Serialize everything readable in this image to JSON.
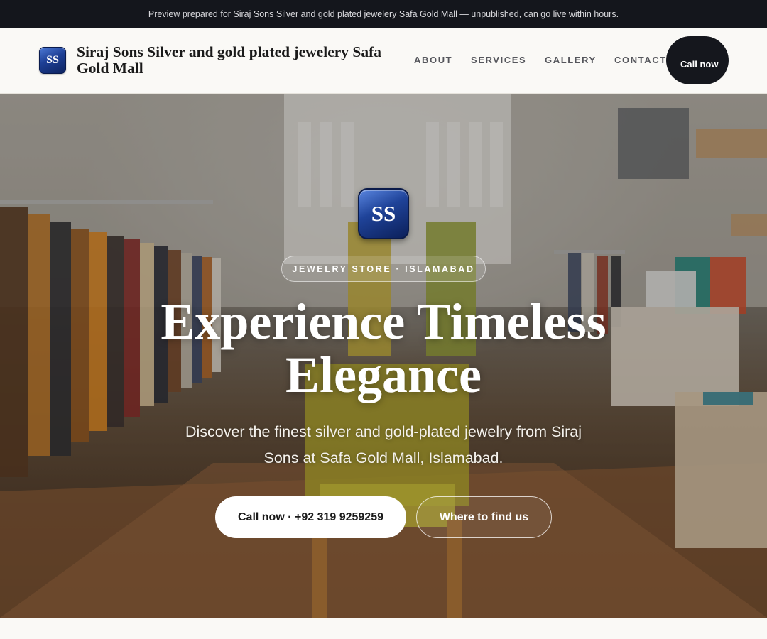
{
  "preview_bar": {
    "text": "Preview prepared for Siraj Sons Silver and gold plated jewelery Safa Gold Mall — unpublished, can go live within hours."
  },
  "header": {
    "logo_initials": "SS",
    "brand_name": "Siraj Sons Silver and gold plated jewelery Safa Gold Mall",
    "nav": [
      {
        "label": "ABOUT"
      },
      {
        "label": "SERVICES"
      },
      {
        "label": "GALLERY"
      },
      {
        "label": "CONTACT"
      }
    ],
    "cta_label": "Call now"
  },
  "hero": {
    "logo_initials": "SS",
    "badge": "JEWELRY STORE · ISLAMABAD",
    "title": "Experience Timeless Elegance",
    "subtitle": "Discover the finest silver and gold-plated jewelry from Siraj Sons at Safa Gold Mall, Islamabad.",
    "primary_button": "Call now · +92 319 9259259",
    "secondary_button": "Where to find us"
  },
  "colors": {
    "dark": "#14161c",
    "logo_blue": "#1f4399",
    "page_bg": "#faf9f6"
  }
}
